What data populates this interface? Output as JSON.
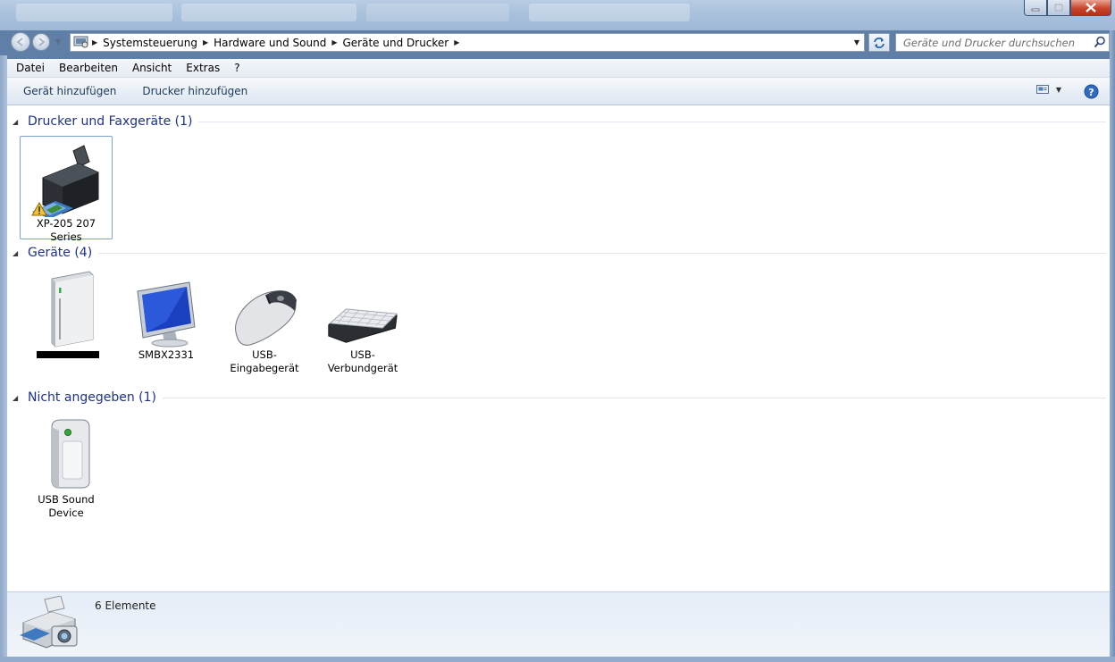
{
  "window": {
    "minimize_icon": "minimize-icon",
    "maximize_icon": "maximize-icon",
    "close_icon": "close-icon"
  },
  "address": {
    "crumbs": [
      "Systemsteuerung",
      "Hardware und Sound",
      "Geräte und Drucker"
    ],
    "search_placeholder": "Geräte und Drucker durchsuchen"
  },
  "menu": [
    "Datei",
    "Bearbeiten",
    "Ansicht",
    "Extras",
    "?"
  ],
  "commands": {
    "add_device": "Gerät hinzufügen",
    "add_printer": "Drucker hinzufügen"
  },
  "groups": {
    "printers": {
      "title": "Drucker und Faxgeräte (1)",
      "items": [
        {
          "label": "XP-205 207 Series",
          "icon": "printer-warning-icon"
        }
      ]
    },
    "devices": {
      "title": "Geräte (4)",
      "items": [
        {
          "label": "",
          "icon": "computer-tower-icon"
        },
        {
          "label": "SMBX2331",
          "icon": "monitor-icon"
        },
        {
          "label": "USB-Eingabegerät",
          "icon": "mouse-icon"
        },
        {
          "label": "USB-Verbundgerät",
          "icon": "keyboard-icon"
        }
      ]
    },
    "unspecified": {
      "title": "Nicht angegeben (1)",
      "items": [
        {
          "label": "USB Sound Device",
          "icon": "generic-device-icon"
        }
      ]
    }
  },
  "status": {
    "count": "6 Elemente"
  },
  "colors": {
    "group_title": "#1e3287",
    "command_text": "#1e395b",
    "titlebar": "#a9c1dc"
  }
}
